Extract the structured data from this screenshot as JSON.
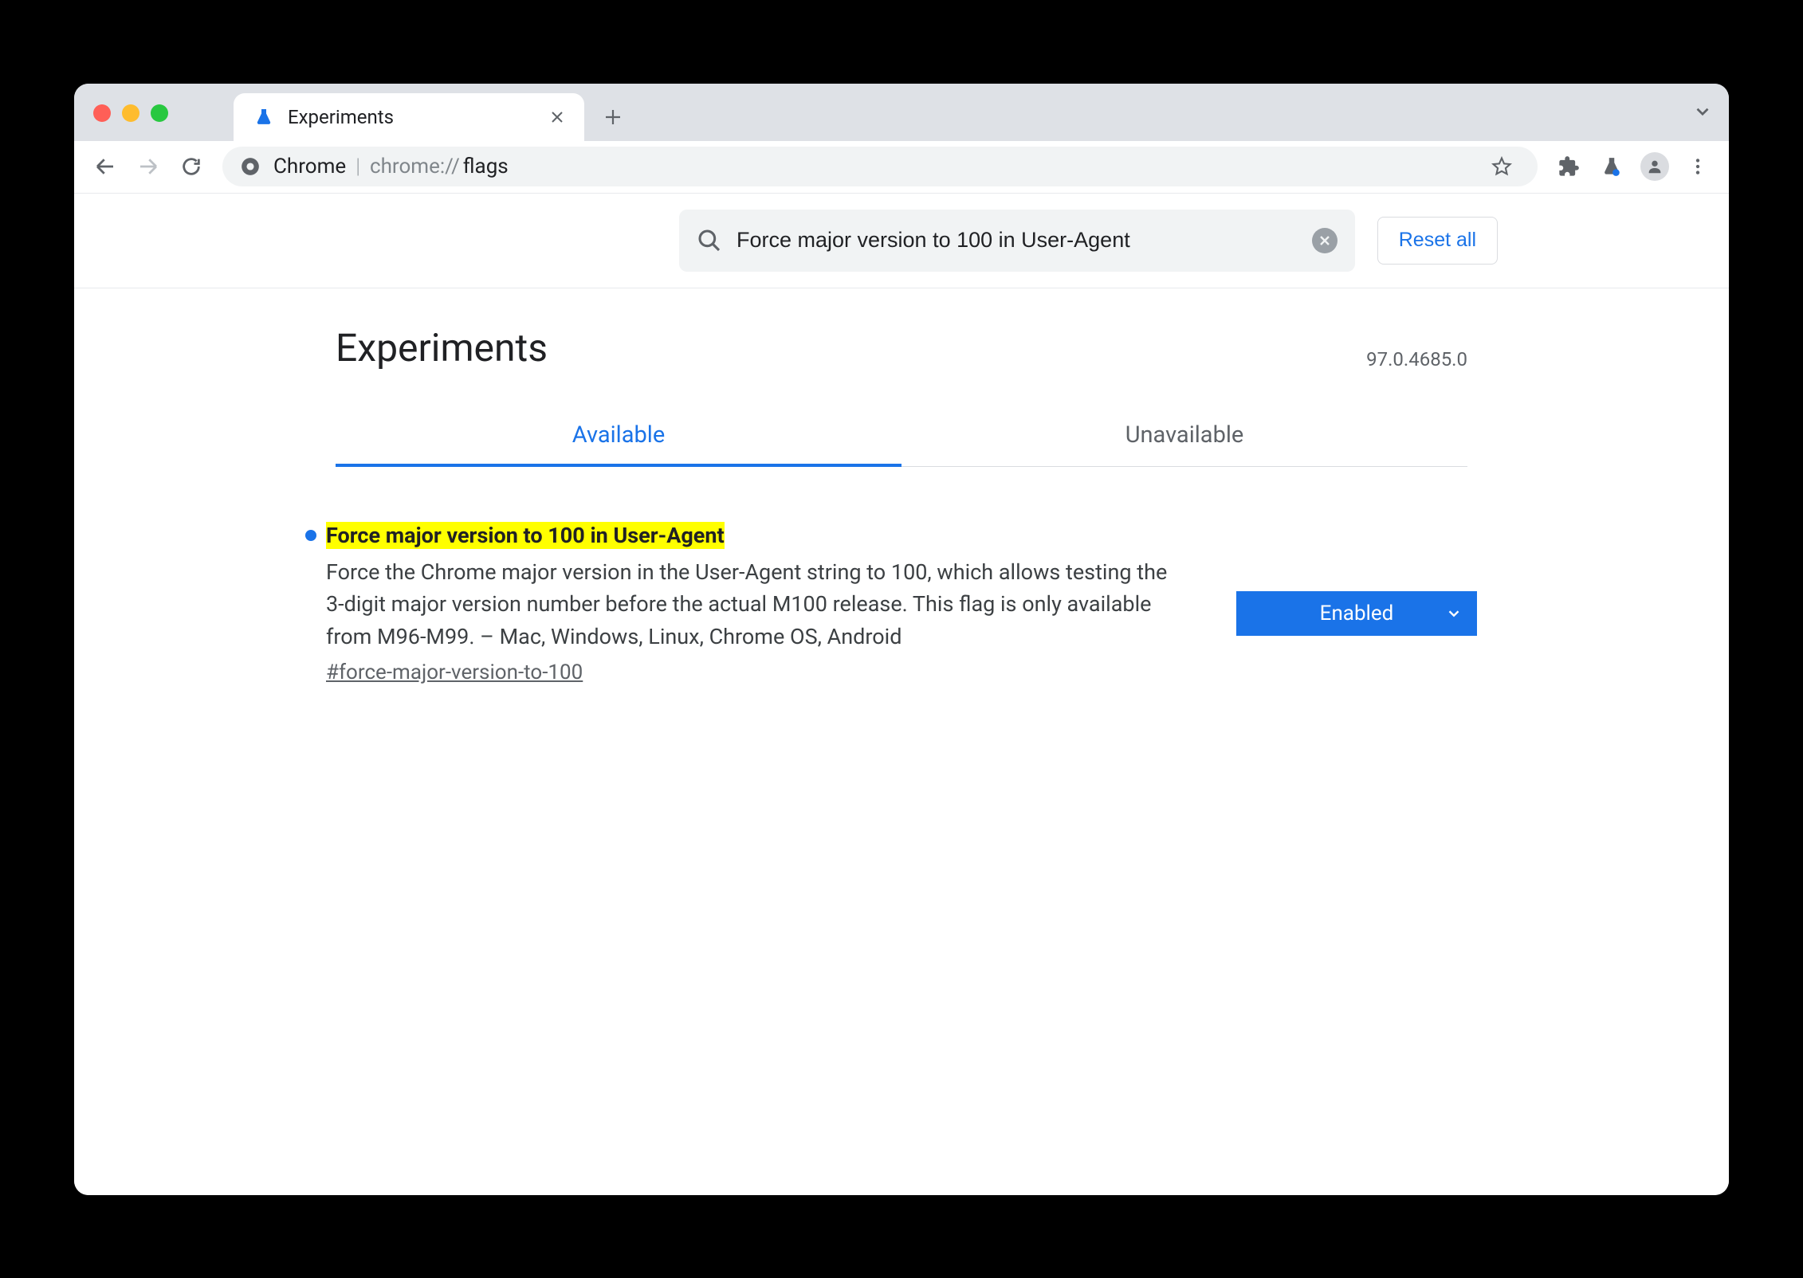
{
  "browser": {
    "tab": {
      "title": "Experiments"
    },
    "omnibox": {
      "origin": "Chrome",
      "url_prefix": "chrome://",
      "url_path": "flags"
    }
  },
  "search": {
    "value": "Force major version to 100 in User-Agent",
    "reset_label": "Reset all"
  },
  "header": {
    "title": "Experiments",
    "version": "97.0.4685.0"
  },
  "tabs": {
    "available": "Available",
    "unavailable": "Unavailable"
  },
  "flag": {
    "title": "Force major version to 100 in User-Agent",
    "description": "Force the Chrome major version in the User-Agent string to 100, which allows testing the 3-digit major version number before the actual M100 release. This flag is only available from M96-M99. – Mac, Windows, Linux, Chrome OS, Android",
    "hash": "#force-major-version-to-100",
    "select_value": "Enabled"
  }
}
